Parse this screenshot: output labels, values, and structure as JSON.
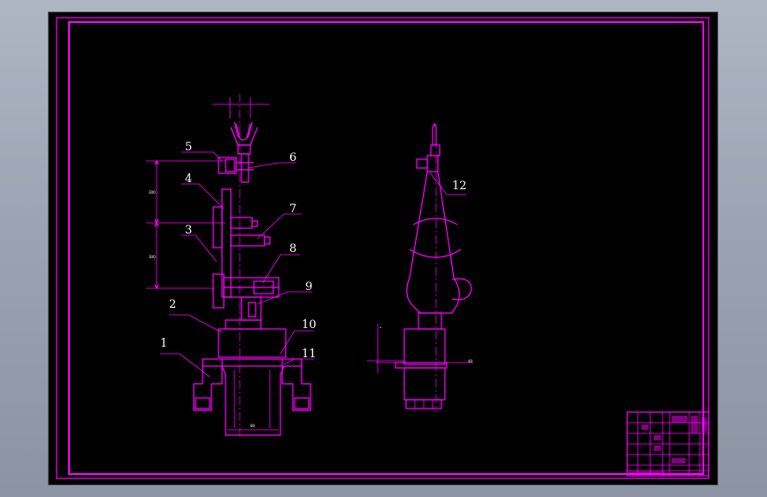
{
  "colors": {
    "background": "#000000",
    "line": "#ff00ff",
    "text": "#ffffff",
    "window_frame": "#9aa2b1"
  },
  "callouts": {
    "c1": "1",
    "c2": "2",
    "c3": "3",
    "c4": "4",
    "c5": "5",
    "c6": "6",
    "c7": "7",
    "c8": "8",
    "c9": "9",
    "c10": "10",
    "c11": "11",
    "c12": "12"
  }
}
